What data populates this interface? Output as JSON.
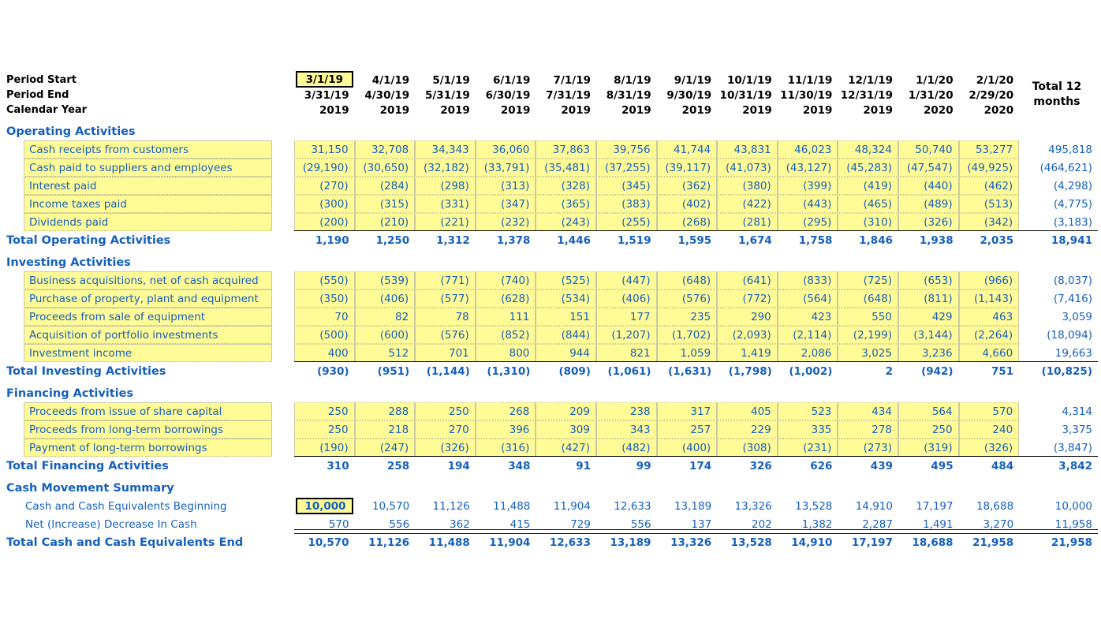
{
  "header": {
    "row_labels": [
      "Period Start",
      "Period End",
      "Calendar Year"
    ],
    "total_col_line1": "Total 12",
    "total_col_line2": "months",
    "period_start": [
      "3/1/19",
      "4/1/19",
      "5/1/19",
      "6/1/19",
      "7/1/19",
      "8/1/19",
      "9/1/19",
      "10/1/19",
      "11/1/19",
      "12/1/19",
      "1/1/20",
      "2/1/20"
    ],
    "period_end": [
      "3/31/19",
      "4/30/19",
      "5/31/19",
      "6/30/19",
      "7/31/19",
      "8/31/19",
      "9/30/19",
      "10/31/19",
      "11/30/19",
      "12/31/19",
      "1/31/20",
      "2/29/20"
    ],
    "calendar_year": [
      "2019",
      "2019",
      "2019",
      "2019",
      "2019",
      "2019",
      "2019",
      "2019",
      "2019",
      "2019",
      "2020",
      "2020"
    ],
    "selected_cell": "3/1/19"
  },
  "colors": {
    "text_blue": "#1560BD",
    "cell_yellow": "#FFFB96",
    "header_black": "#000000"
  },
  "sections": [
    {
      "title": "Operating Activities",
      "rows": [
        {
          "label": "Cash receipts from customers",
          "values": [
            "31,150",
            "32,708",
            "34,343",
            "36,060",
            "37,863",
            "39,756",
            "41,744",
            "43,831",
            "46,023",
            "48,324",
            "50,740",
            "53,277"
          ],
          "total": "495,818"
        },
        {
          "label": "Cash paid to suppliers and employees",
          "values": [
            "(29,190)",
            "(30,650)",
            "(32,182)",
            "(33,791)",
            "(35,481)",
            "(37,255)",
            "(39,117)",
            "(41,073)",
            "(43,127)",
            "(45,283)",
            "(47,547)",
            "(49,925)"
          ],
          "total": "(464,621)"
        },
        {
          "label": "Interest paid",
          "values": [
            "(270)",
            "(284)",
            "(298)",
            "(313)",
            "(328)",
            "(345)",
            "(362)",
            "(380)",
            "(399)",
            "(419)",
            "(440)",
            "(462)"
          ],
          "total": "(4,298)"
        },
        {
          "label": "Income taxes paid",
          "values": [
            "(300)",
            "(315)",
            "(331)",
            "(347)",
            "(365)",
            "(383)",
            "(402)",
            "(422)",
            "(443)",
            "(465)",
            "(489)",
            "(513)"
          ],
          "total": "(4,775)"
        },
        {
          "label": "Dividends paid",
          "values": [
            "(200)",
            "(210)",
            "(221)",
            "(232)",
            "(243)",
            "(255)",
            "(268)",
            "(281)",
            "(295)",
            "(310)",
            "(326)",
            "(342)"
          ],
          "total": "(3,183)"
        }
      ],
      "total_row": {
        "label": "Total Operating Activities",
        "values": [
          "1,190",
          "1,250",
          "1,312",
          "1,378",
          "1,446",
          "1,519",
          "1,595",
          "1,674",
          "1,758",
          "1,846",
          "1,938",
          "2,035"
        ],
        "total": "18,941"
      }
    },
    {
      "title": "Investing Activities",
      "rows": [
        {
          "label": "Business acquisitions, net of cash acquired",
          "values": [
            "(550)",
            "(539)",
            "(771)",
            "(740)",
            "(525)",
            "(447)",
            "(648)",
            "(641)",
            "(833)",
            "(725)",
            "(653)",
            "(966)"
          ],
          "total": "(8,037)"
        },
        {
          "label": "Purchase of property, plant and equipment",
          "values": [
            "(350)",
            "(406)",
            "(577)",
            "(628)",
            "(534)",
            "(406)",
            "(576)",
            "(772)",
            "(564)",
            "(648)",
            "(811)",
            "(1,143)"
          ],
          "total": "(7,416)"
        },
        {
          "label": "Proceeds from sale of equipment",
          "values": [
            "70",
            "82",
            "78",
            "111",
            "151",
            "177",
            "235",
            "290",
            "423",
            "550",
            "429",
            "463"
          ],
          "total": "3,059"
        },
        {
          "label": "Acquisition of portfolio investments",
          "values": [
            "(500)",
            "(600)",
            "(576)",
            "(852)",
            "(844)",
            "(1,207)",
            "(1,702)",
            "(2,093)",
            "(2,114)",
            "(2,199)",
            "(3,144)",
            "(2,264)"
          ],
          "total": "(18,094)"
        },
        {
          "label": "Investment income",
          "values": [
            "400",
            "512",
            "701",
            "800",
            "944",
            "821",
            "1,059",
            "1,419",
            "2,086",
            "3,025",
            "3,236",
            "4,660"
          ],
          "total": "19,663"
        }
      ],
      "total_row": {
        "label": "Total Investing Activities",
        "values": [
          "(930)",
          "(951)",
          "(1,144)",
          "(1,310)",
          "(809)",
          "(1,061)",
          "(1,631)",
          "(1,798)",
          "(1,002)",
          "2",
          "(942)",
          "751"
        ],
        "total": "(10,825)"
      }
    },
    {
      "title": "Financing Activities",
      "rows": [
        {
          "label": "Proceeds from issue of share capital",
          "values": [
            "250",
            "288",
            "250",
            "268",
            "209",
            "238",
            "317",
            "405",
            "523",
            "434",
            "564",
            "570"
          ],
          "total": "4,314"
        },
        {
          "label": "Proceeds from long-term borrowings",
          "values": [
            "250",
            "218",
            "270",
            "396",
            "309",
            "343",
            "257",
            "229",
            "335",
            "278",
            "250",
            "240"
          ],
          "total": "3,375"
        },
        {
          "label": "Payment of long-term borrowings",
          "values": [
            "(190)",
            "(247)",
            "(326)",
            "(316)",
            "(427)",
            "(482)",
            "(400)",
            "(308)",
            "(231)",
            "(273)",
            "(319)",
            "(326)"
          ],
          "total": "(3,847)"
        }
      ],
      "total_row": {
        "label": "Total Financing Activities",
        "values": [
          "310",
          "258",
          "194",
          "348",
          "91",
          "99",
          "174",
          "326",
          "626",
          "439",
          "495",
          "484"
        ],
        "total": "3,842"
      }
    }
  ],
  "summary": {
    "title": "Cash Movement Summary",
    "rows": [
      {
        "label": "Cash and Cash Equivalents Beginning",
        "values": [
          "10,000",
          "10,570",
          "11,126",
          "11,488",
          "11,904",
          "12,633",
          "13,189",
          "13,326",
          "13,528",
          "14,910",
          "17,197",
          "18,688"
        ],
        "total": "10,000",
        "selected_first": true
      },
      {
        "label": "Net (Increase) Decrease In Cash",
        "values": [
          "570",
          "556",
          "362",
          "415",
          "729",
          "556",
          "137",
          "202",
          "1,382",
          "2,287",
          "1,491",
          "3,270"
        ],
        "total": "11,958"
      }
    ],
    "total_row": {
      "label": "Total Cash and Cash Equivalents End",
      "values": [
        "10,570",
        "11,126",
        "11,488",
        "11,904",
        "12,633",
        "13,189",
        "13,326",
        "13,528",
        "14,910",
        "17,197",
        "18,688",
        "21,958"
      ],
      "total": "21,958"
    }
  }
}
